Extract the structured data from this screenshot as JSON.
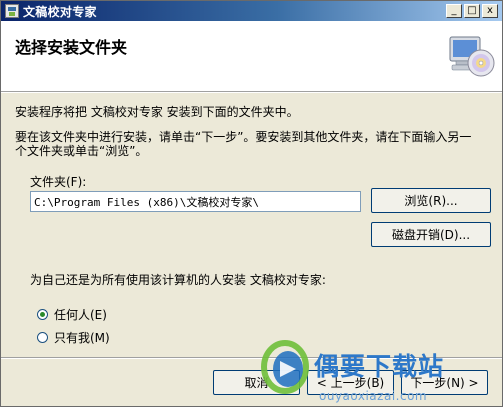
{
  "window": {
    "title": "文稿校对专家",
    "controls": {
      "minimize": "_",
      "maximize": "□",
      "close": "x"
    }
  },
  "header": {
    "title": "选择安装文件夹",
    "icon": "computer-cd-icon"
  },
  "body": {
    "intro": "安装程序将把 文稿校对专家 安装到下面的文件夹中。",
    "instructions_line1": "要在该文件夹中进行安装，请单击“下一步”。要安装到其他文件夹，请在下面输入另一",
    "instructions_line2": "个文件夹或单击“浏览”。"
  },
  "folder": {
    "label": "文件夹(F):",
    "value": "C:\\Program Files (x86)\\文稿校对专家\\",
    "browse_label": "浏览(R)...",
    "disk_cost_label": "磁盘开销(D)..."
  },
  "install_for": {
    "question": "为自己还是为所有使用该计算机的人安装 文稿校对专家:",
    "options": [
      {
        "label": "任何人(E)",
        "selected": true
      },
      {
        "label": "只有我(M)",
        "selected": false
      }
    ]
  },
  "footer": {
    "cancel_label": "取消",
    "back_label": "< 上一步(B)",
    "next_label": "下一步(N) >"
  },
  "watermark": {
    "title": "偶要下载站",
    "url": "ouyaoxiazai.com"
  },
  "colors": {
    "titlebar_start": "#0a246a",
    "titlebar_end": "#a6caf0",
    "dialog_bg": "#ece9d8",
    "watermark_blue": "#2d78c9",
    "radio_dot": "#2a8a2a"
  }
}
